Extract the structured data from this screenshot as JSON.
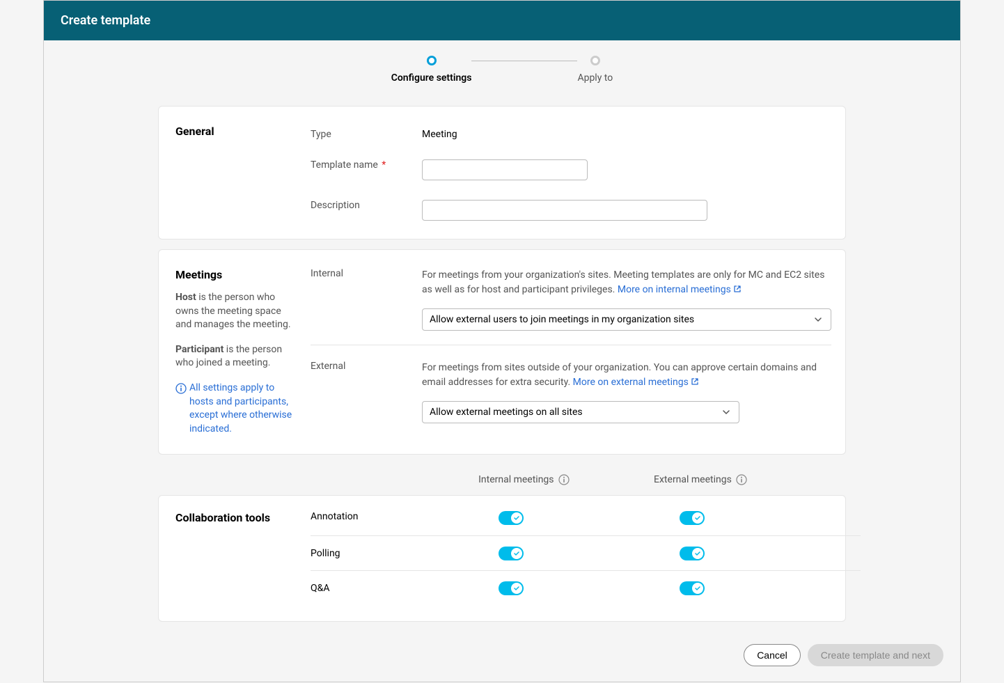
{
  "header": {
    "title": "Create template"
  },
  "stepper": {
    "steps": [
      {
        "label": "Configure settings",
        "active": true
      },
      {
        "label": "Apply to",
        "active": false
      }
    ]
  },
  "general": {
    "heading": "General",
    "type_label": "Type",
    "type_value": "Meeting",
    "name_label": "Template name",
    "desc_label": "Description",
    "name_value": "",
    "desc_value": ""
  },
  "meetings": {
    "heading": "Meetings",
    "host_bold": "Host",
    "host_text": " is the person who owns the meeting space and manages the meeting.",
    "participant_bold": "Participant",
    "participant_text": " is the person who joined a meeting.",
    "note": "All settings apply to hosts and participants, except where otherwise indicated.",
    "internal": {
      "label": "Internal",
      "desc": "For meetings from your organization's sites. Meeting templates are only for MC and EC2 sites as well as for host and participant privileges. ",
      "link": "More on internal meetings",
      "select": "Allow external users to join meetings in my organization sites"
    },
    "external": {
      "label": "External",
      "desc": "For meetings from sites outside of your organization. You can approve certain domains and email addresses for extra security. ",
      "link": "More on external meetings",
      "select": "Allow external meetings on all sites"
    }
  },
  "columns": {
    "internal": "Internal meetings",
    "external": "External meetings"
  },
  "collab": {
    "heading": "Collaboration tools",
    "rows": [
      {
        "label": "Annotation",
        "internal": true,
        "external": true
      },
      {
        "label": "Polling",
        "internal": true,
        "external": true
      },
      {
        "label": "Q&A",
        "internal": true,
        "external": true
      }
    ]
  },
  "footer": {
    "cancel": "Cancel",
    "next": "Create template and next"
  }
}
